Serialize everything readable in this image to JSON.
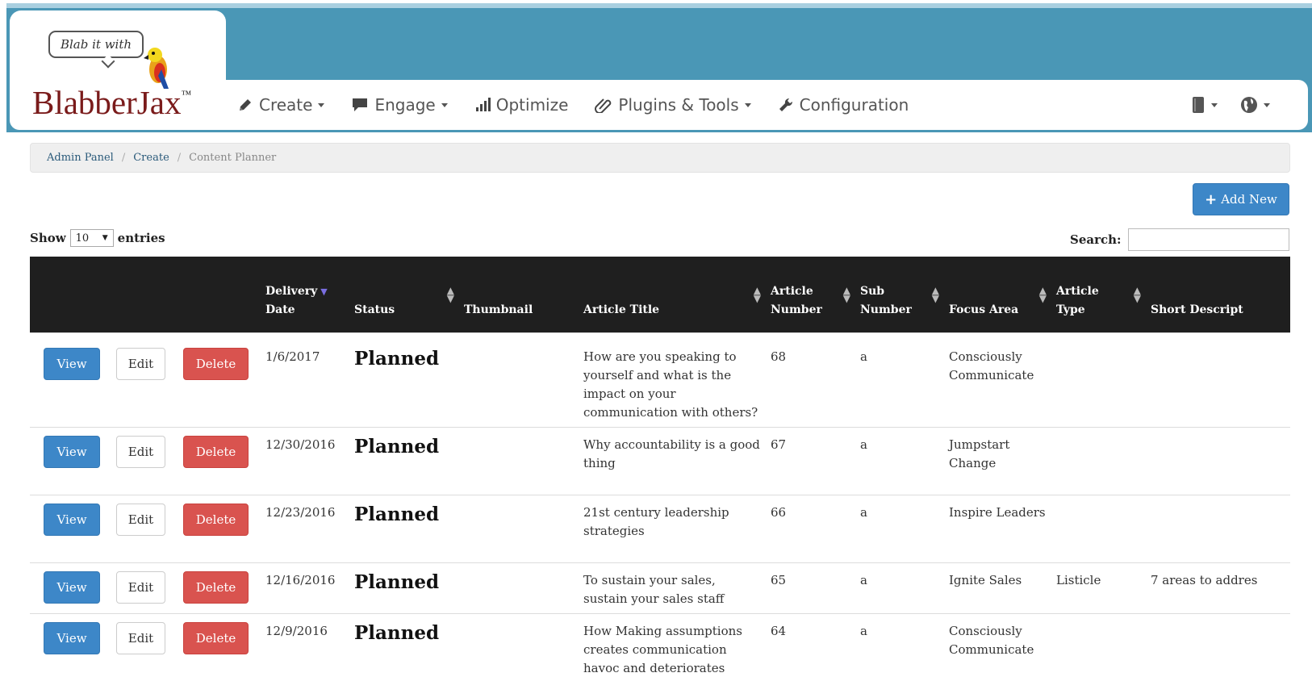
{
  "header": {
    "tagline": "Blab it with",
    "brand_name": "BlabberJax",
    "brand_tm": "™"
  },
  "nav": {
    "items": [
      {
        "label": "Create",
        "icon": "pencil-icon",
        "dropdown": true
      },
      {
        "label": "Engage",
        "icon": "comment-icon",
        "dropdown": true
      },
      {
        "label": "Optimize",
        "icon": "signal-bars-icon",
        "dropdown": false
      },
      {
        "label": "Plugins & Tools",
        "icon": "paperclip-icon",
        "dropdown": true
      },
      {
        "label": "Configuration",
        "icon": "wrench-icon",
        "dropdown": false
      }
    ],
    "right_tools": [
      "book-icon",
      "globe-icon"
    ]
  },
  "breadcrumb": {
    "items": [
      "Admin Panel",
      "Create",
      "Content Planner"
    ]
  },
  "toolbar": {
    "add_new_label": "Add New"
  },
  "table_controls": {
    "show_label": "Show",
    "entries_value": "10",
    "entries_label": "entries",
    "search_label": "Search:",
    "search_value": ""
  },
  "table": {
    "columns": [
      {
        "label": "",
        "line2": ""
      },
      {
        "label": "Delivery",
        "line2": "Date"
      },
      {
        "label": "",
        "line2": "Status"
      },
      {
        "label": "",
        "line2": "Thumbnail"
      },
      {
        "label": "",
        "line2": "Article Title"
      },
      {
        "label": "Article",
        "line2": "Number"
      },
      {
        "label": "Sub",
        "line2": "Number"
      },
      {
        "label": "",
        "line2": "Focus Area"
      },
      {
        "label": "Article",
        "line2": "Type"
      },
      {
        "label": "",
        "line2": "Short Descript"
      }
    ],
    "action_labels": {
      "view": "View",
      "edit": "Edit",
      "delete": "Delete"
    },
    "rows": [
      {
        "date": "1/6/2017",
        "status": "Planned",
        "title": "How are you speaking to yourself and what is the impact on your communication with others?",
        "number": "68",
        "sub": "a",
        "focus": "Consciously Communicate",
        "type": "",
        "short": ""
      },
      {
        "date": "12/30/2016",
        "status": "Planned",
        "title": "Why accountability is a good thing",
        "number": "67",
        "sub": "a",
        "focus": "Jumpstart Change",
        "type": "",
        "short": ""
      },
      {
        "date": "12/23/2016",
        "status": "Planned",
        "title": "21st century leadership strategies",
        "number": "66",
        "sub": "a",
        "focus": "Inspire Leaders",
        "type": "",
        "short": ""
      },
      {
        "date": "12/16/2016",
        "status": "Planned",
        "title": "To sustain your sales, sustain your sales staff",
        "number": "65",
        "sub": "a",
        "focus": "Ignite Sales",
        "type": "Listicle",
        "short": "7 areas to addres"
      },
      {
        "date": "12/9/2016",
        "status": "Planned",
        "title": "How Making assumptions creates communication havoc and deteriorates",
        "number": "64",
        "sub": "a",
        "focus": "Consciously Communicate",
        "type": "",
        "short": ""
      }
    ]
  },
  "colors": {
    "banner": "#4a97b6",
    "brand_text": "#7a1b1b",
    "primary_button": "#3d87c8",
    "danger_button": "#d9534f",
    "table_header": "#1f1f1f"
  }
}
